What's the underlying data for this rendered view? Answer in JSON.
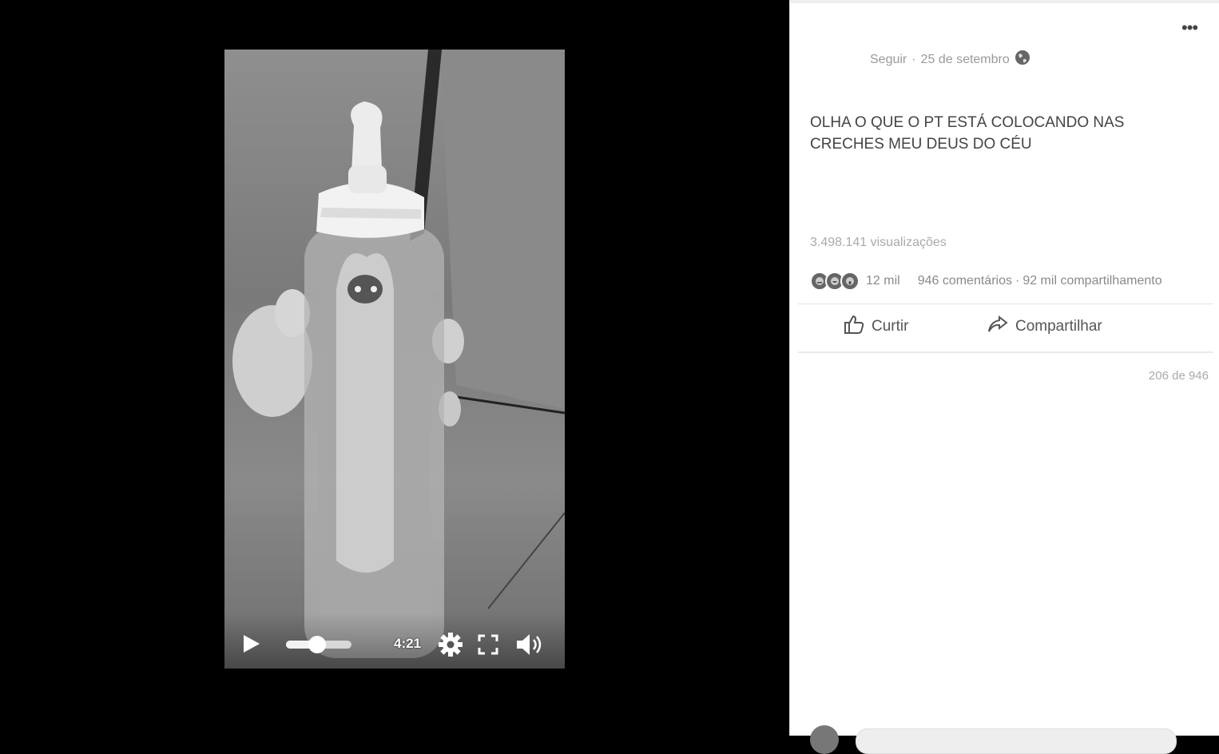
{
  "video": {
    "time": "4:21",
    "progress": 0.47,
    "controls": {
      "play_icon": "play-icon",
      "settings_icon": "gear-icon",
      "fullscreen_icon": "fullscreen-icon",
      "volume_icon": "volume-icon"
    }
  },
  "post": {
    "follow_label": "Seguir",
    "date": "25 de setembro",
    "privacy_icon": "globe-icon",
    "more_label": "•••",
    "text": "OLHA O QUE O PT ESTÁ COLOCANDO NAS CRECHES MEU DEUS DO CÉU",
    "views": "3.498.141 visualizações",
    "reactions_count": "12 mil",
    "comments": "946 comentários",
    "shares": "92 mil compartilhamento",
    "separator": "·",
    "like_label": "Curtir",
    "share_label": "Compartilhar",
    "comment_page": "206 de 946"
  },
  "colors": {
    "panel_bg": "#ffffff",
    "viewer_bg": "#000000",
    "text": "#555555"
  }
}
